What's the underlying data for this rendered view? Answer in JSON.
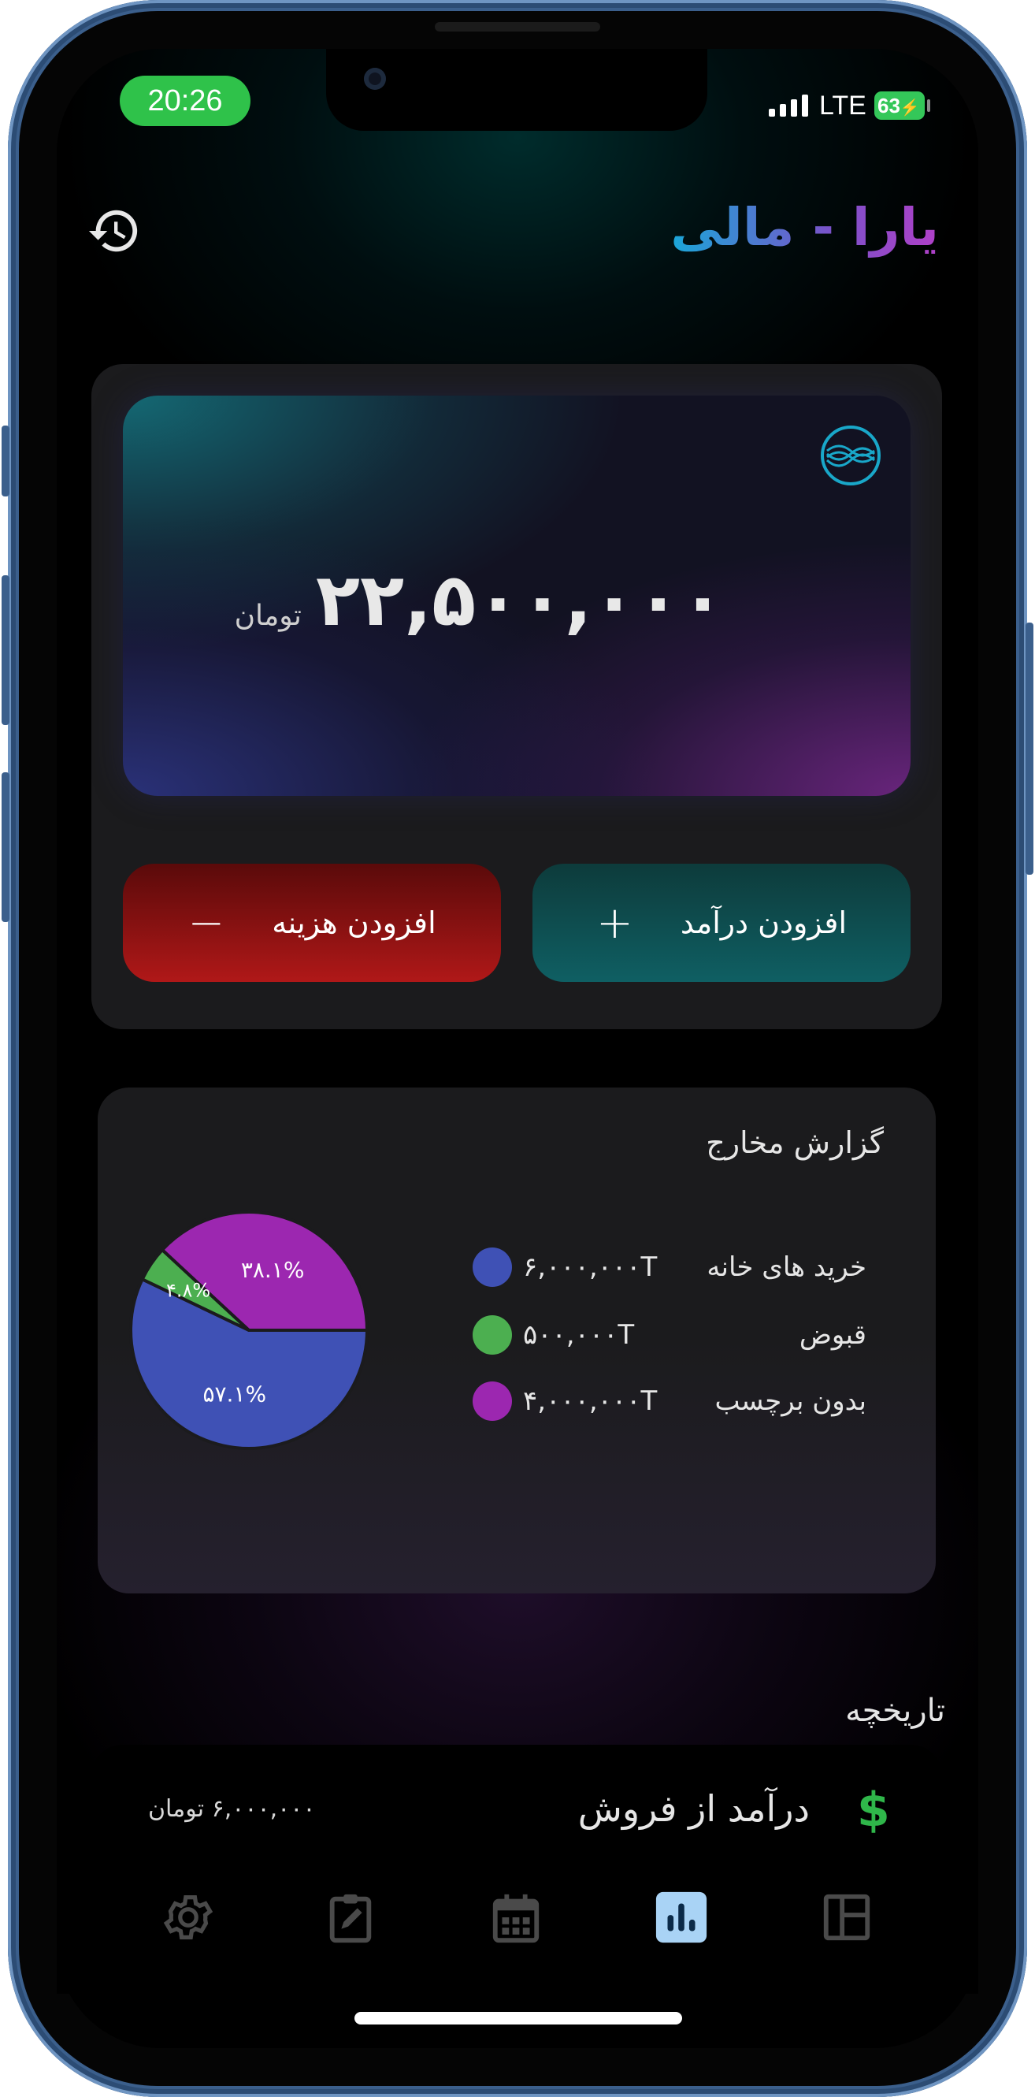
{
  "status_bar": {
    "time": "20:26",
    "network": "LTE",
    "battery": "63"
  },
  "header": {
    "title": "یارا - مالی",
    "history_icon": "history-icon"
  },
  "balance_card": {
    "amount": "۲۲,۵۰۰,۰۰۰",
    "unit": "تومان",
    "logo_icon": "wave-logo-icon"
  },
  "actions": {
    "add_income_label": "افزودن درآمد",
    "add_income_symbol": "+",
    "add_expense_label": "افزودن هزینه",
    "add_expense_symbol": "−"
  },
  "report": {
    "title": "گزارش مخارج",
    "legend": [
      {
        "name": "خرید های خانه",
        "value": "۶,۰۰۰,۰۰۰T",
        "color": "#3f51b5"
      },
      {
        "name": "قبوض",
        "value": "۵۰۰,۰۰۰T",
        "color": "#4caf50"
      },
      {
        "name": "بدون برچسب",
        "value": "۴,۰۰۰,۰۰۰T",
        "color": "#9c27b0"
      }
    ]
  },
  "chart_data": {
    "type": "pie",
    "categories": [
      "خرید های خانه",
      "قبوض",
      "بدون برچسب"
    ],
    "values": [
      57.1,
      4.8,
      38.1
    ],
    "labels": [
      "۵۷.۱%",
      "۴.۸%",
      "۳۸.۱%"
    ],
    "colors": [
      "#3f51b5",
      "#4caf50",
      "#9c27b0"
    ]
  },
  "history": {
    "title": "تاریخچه",
    "items": [
      {
        "title": "درآمد از فروش",
        "amount": "۶,۰۰۰,۰۰۰ تومان",
        "icon": "dollar-icon",
        "icon_glyph": "$"
      }
    ]
  },
  "nav": {
    "items": [
      {
        "name": "settings",
        "icon": "gear-icon",
        "active": false
      },
      {
        "name": "notes",
        "icon": "clipboard-edit-icon",
        "active": false
      },
      {
        "name": "calendar",
        "icon": "calendar-icon",
        "active": false
      },
      {
        "name": "reports",
        "icon": "bar-chart-icon",
        "active": true
      },
      {
        "name": "dashboard",
        "icon": "layout-icon",
        "active": false
      }
    ]
  }
}
